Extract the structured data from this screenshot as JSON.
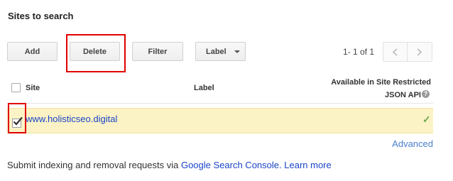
{
  "section": {
    "title": "Sites to search"
  },
  "toolbar": {
    "add_label": "Add",
    "delete_label": "Delete",
    "filter_label": "Filter",
    "label_dropdown": "Label"
  },
  "pagination": {
    "range_text": "1- 1 of 1"
  },
  "table": {
    "headers": {
      "site": "Site",
      "label": "Label",
      "available_line1": "Available in Site Restricted",
      "available_line2": "JSON API",
      "help_glyph": "?"
    },
    "rows": [
      {
        "site": "www.holisticseo.digital",
        "label": "",
        "available_mark": "✓",
        "checked": true
      }
    ]
  },
  "advanced_link": "Advanced",
  "footer": {
    "text_before": "Submit indexing and removal requests via ",
    "console_link": "Google Search Console.",
    "learn_more": "Learn more"
  },
  "colors": {
    "highlight_border": "#e00000",
    "selected_row_bg": "#fbf3c5",
    "link": "#1a44c8",
    "check_green": "#6aa84f"
  }
}
